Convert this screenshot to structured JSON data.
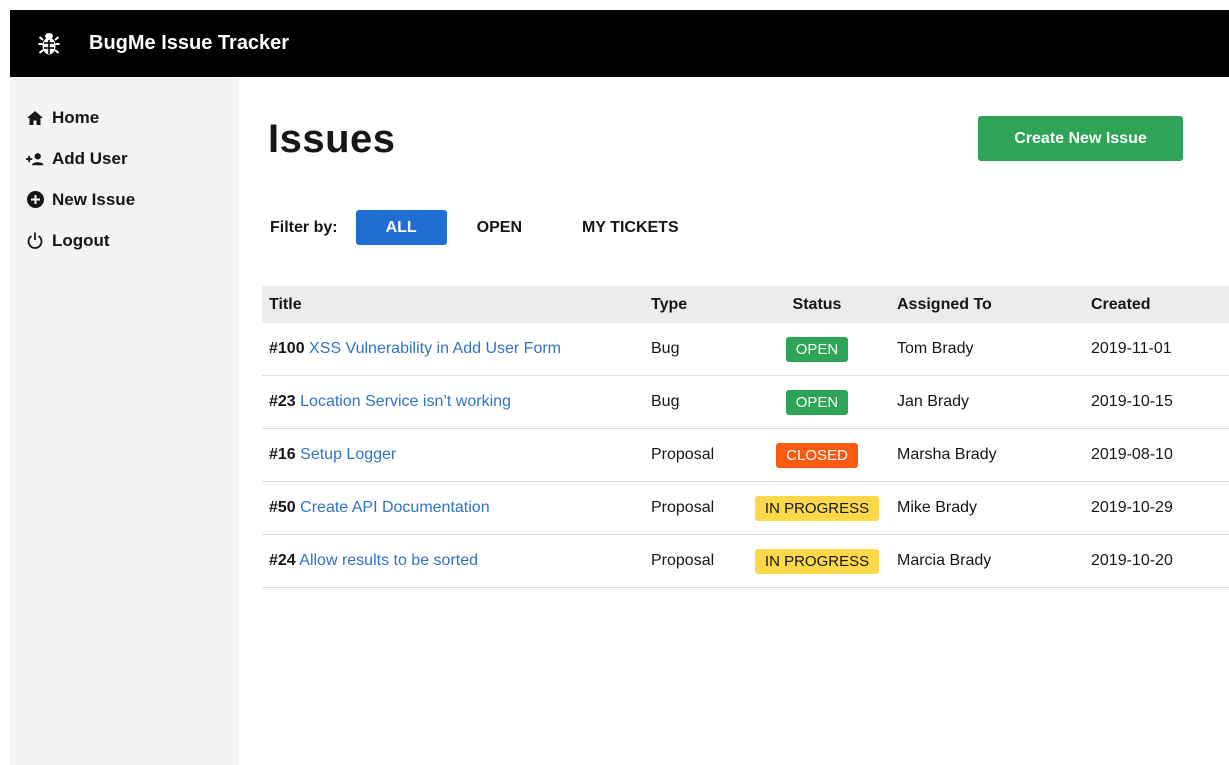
{
  "app": {
    "title": "BugMe Issue Tracker",
    "logo_icon": "bug-icon"
  },
  "sidebar": {
    "items": [
      {
        "label": "Home",
        "icon": "home-icon"
      },
      {
        "label": "Add User",
        "icon": "add-user-icon"
      },
      {
        "label": "New Issue",
        "icon": "plus-circle-icon"
      },
      {
        "label": "Logout",
        "icon": "power-icon"
      }
    ]
  },
  "main": {
    "title": "Issues",
    "create_button": "Create New Issue",
    "filter": {
      "label": "Filter by:",
      "options": [
        "ALL",
        "OPEN",
        "MY TICKETS"
      ],
      "selected": "ALL"
    },
    "table": {
      "headers": [
        "Title",
        "Type",
        "Status",
        "Assigned To",
        "Created"
      ],
      "rows": [
        {
          "id": "#100",
          "title": "XSS Vulnerability in Add User Form",
          "type": "Bug",
          "status": "OPEN",
          "assigned": "Tom Brady",
          "created": "2019-11-01"
        },
        {
          "id": "#23",
          "title": "Location Service isn’t working",
          "type": "Bug",
          "status": "OPEN",
          "assigned": "Jan Brady",
          "created": "2019-10-15"
        },
        {
          "id": "#16",
          "title": "Setup Logger",
          "type": "Proposal",
          "status": "CLOSED",
          "assigned": "Marsha Brady",
          "created": "2019-08-10"
        },
        {
          "id": "#50",
          "title": "Create API Documentation",
          "type": "Proposal",
          "status": "IN PROGRESS",
          "assigned": "Mike Brady",
          "created": "2019-10-29"
        },
        {
          "id": "#24",
          "title": "Allow results to be sorted",
          "type": "Proposal",
          "status": "IN PROGRESS",
          "assigned": "Marcia Brady",
          "created": "2019-10-20"
        }
      ]
    }
  },
  "colors": {
    "topbar": "#000000",
    "sidebar": "#f4f4f4",
    "primary_blue": "#1f6ed4",
    "link_blue": "#2f73c9",
    "green": "#2ea456",
    "closed_orange": "#fa5b0f",
    "progress_yellow": "#fcd84a"
  }
}
